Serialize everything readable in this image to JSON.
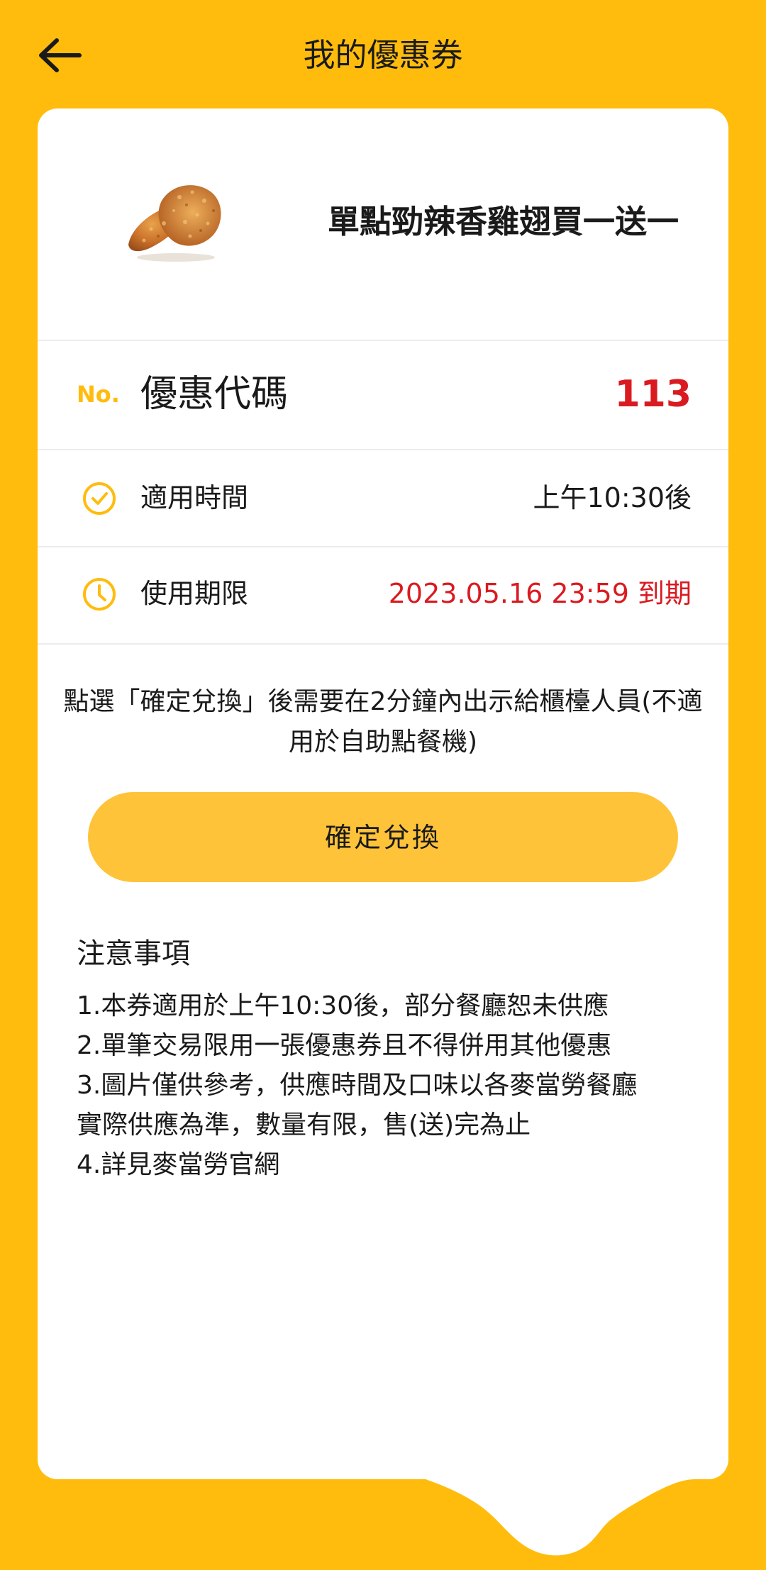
{
  "header": {
    "title": "我的優惠券",
    "back_icon": "back-arrow-icon"
  },
  "colors": {
    "brand_yellow": "#FFBC0D",
    "button_yellow": "#FFC33A",
    "accent_red": "#DA1A21"
  },
  "coupon": {
    "name": "單點勁辣香雞翅買一送一",
    "image": "fried-chicken-wing"
  },
  "code_row": {
    "prefix": "No.",
    "label": "優惠代碼",
    "value": "113"
  },
  "time_row": {
    "icon": "check-circle-icon",
    "label": "適用時間",
    "value": "上午10:30後"
  },
  "expiry_row": {
    "icon": "clock-icon",
    "label": "使用期限",
    "value": "2023.05.16 23:59 到期"
  },
  "notice": {
    "line1": "點選「確定兌換」後需要在2分鐘內出示給櫃檯人員(不適",
    "line2": "用於自助點餐機)"
  },
  "confirm_button": {
    "label": "確定兌換"
  },
  "notes": {
    "title": "注意事項",
    "items": [
      "1.本券適用於上午10:30後，部分餐廳恕未供應",
      "2.單筆交易限用一張優惠券且不得併用其他優惠",
      "3.圖片僅供參考，供應時間及口味以各麥當勞餐廳",
      "實際供應為準，數量有限，售(送)完為止",
      "4.詳見麥當勞官網"
    ]
  }
}
